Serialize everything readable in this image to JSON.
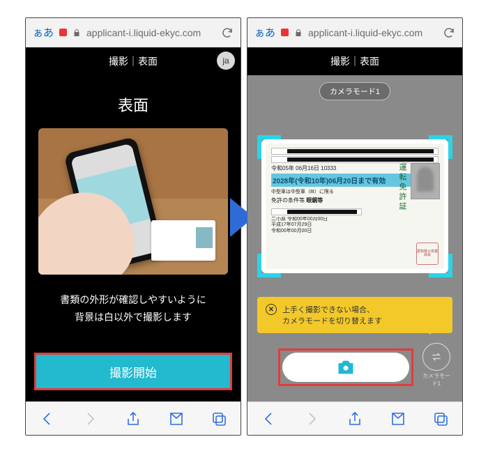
{
  "addressbar": {
    "aa": "ぁあ",
    "url": "applicant-i.liquid-ekyc.com"
  },
  "left": {
    "header_title": "撮影｜表面",
    "lang_badge": "ja",
    "heading": "表面",
    "instruction_line1": "書類の外形が確認しやすいように",
    "instruction_line2": "背景は白以外で撮影します",
    "start_button": "撮影開始"
  },
  "right": {
    "header_title": "撮影｜表面",
    "mode_chip": "カメラモード1",
    "license": {
      "expiry": "2028年(令和10年)06月20日まで有効",
      "date_issued": "令和05年 06月16日  10333",
      "vehicle_note": "中型車は中型車（8t）に限る",
      "conditions_label": "免許の条件等",
      "conditions_value": "眼鏡等",
      "vertical_label": "運転免許証",
      "issuer": "愛知県公安委員会",
      "rows": [
        "二小原 令和00年00月00日",
        "平成17年07月29日",
        "令和00年00月00日"
      ]
    },
    "tip_line1": "上手く撮影できない場合、",
    "tip_line2": "カメラモードを切り替えます",
    "mode_btn_label": "カメラモード1"
  }
}
